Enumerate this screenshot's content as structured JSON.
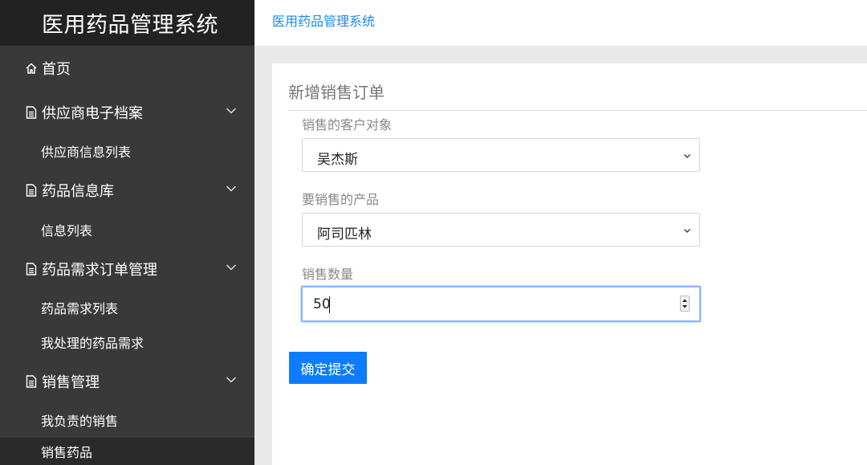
{
  "app": {
    "title": "医用药品管理系统"
  },
  "header": {
    "breadcrumb": "医用药品管理系统"
  },
  "sidebar": {
    "items": [
      {
        "label": "首页",
        "icon": "home-icon"
      },
      {
        "label": "供应商电子档案",
        "icon": "document-icon",
        "expandable": true
      },
      {
        "label": "供应商信息列表",
        "sub": true
      },
      {
        "label": "药品信息库",
        "icon": "document-icon",
        "expandable": true
      },
      {
        "label": "信息列表",
        "sub": true
      },
      {
        "label": "药品需求订单管理",
        "icon": "document-icon",
        "expandable": true
      },
      {
        "label": "药品需求列表",
        "sub": true
      },
      {
        "label": "我处理的药品需求",
        "sub": true
      },
      {
        "label": "销售管理",
        "icon": "document-icon",
        "expandable": true
      },
      {
        "label": "我负责的销售",
        "sub": true
      },
      {
        "label": "销售药品",
        "sub": true,
        "active": true
      }
    ]
  },
  "form": {
    "title": "新增销售订单",
    "customer": {
      "label": "销售的客户对象",
      "value": "吴杰斯"
    },
    "product": {
      "label": "要销售的产品",
      "value": "阿司匹林"
    },
    "quantity": {
      "label": "销售数量",
      "value": "50"
    },
    "submit_label": "确定提交"
  },
  "colors": {
    "sidebar_bg": "#393939",
    "brand_bg": "#222222",
    "accent": "#0d7cff",
    "breadcrumb": "#1e88e5"
  }
}
